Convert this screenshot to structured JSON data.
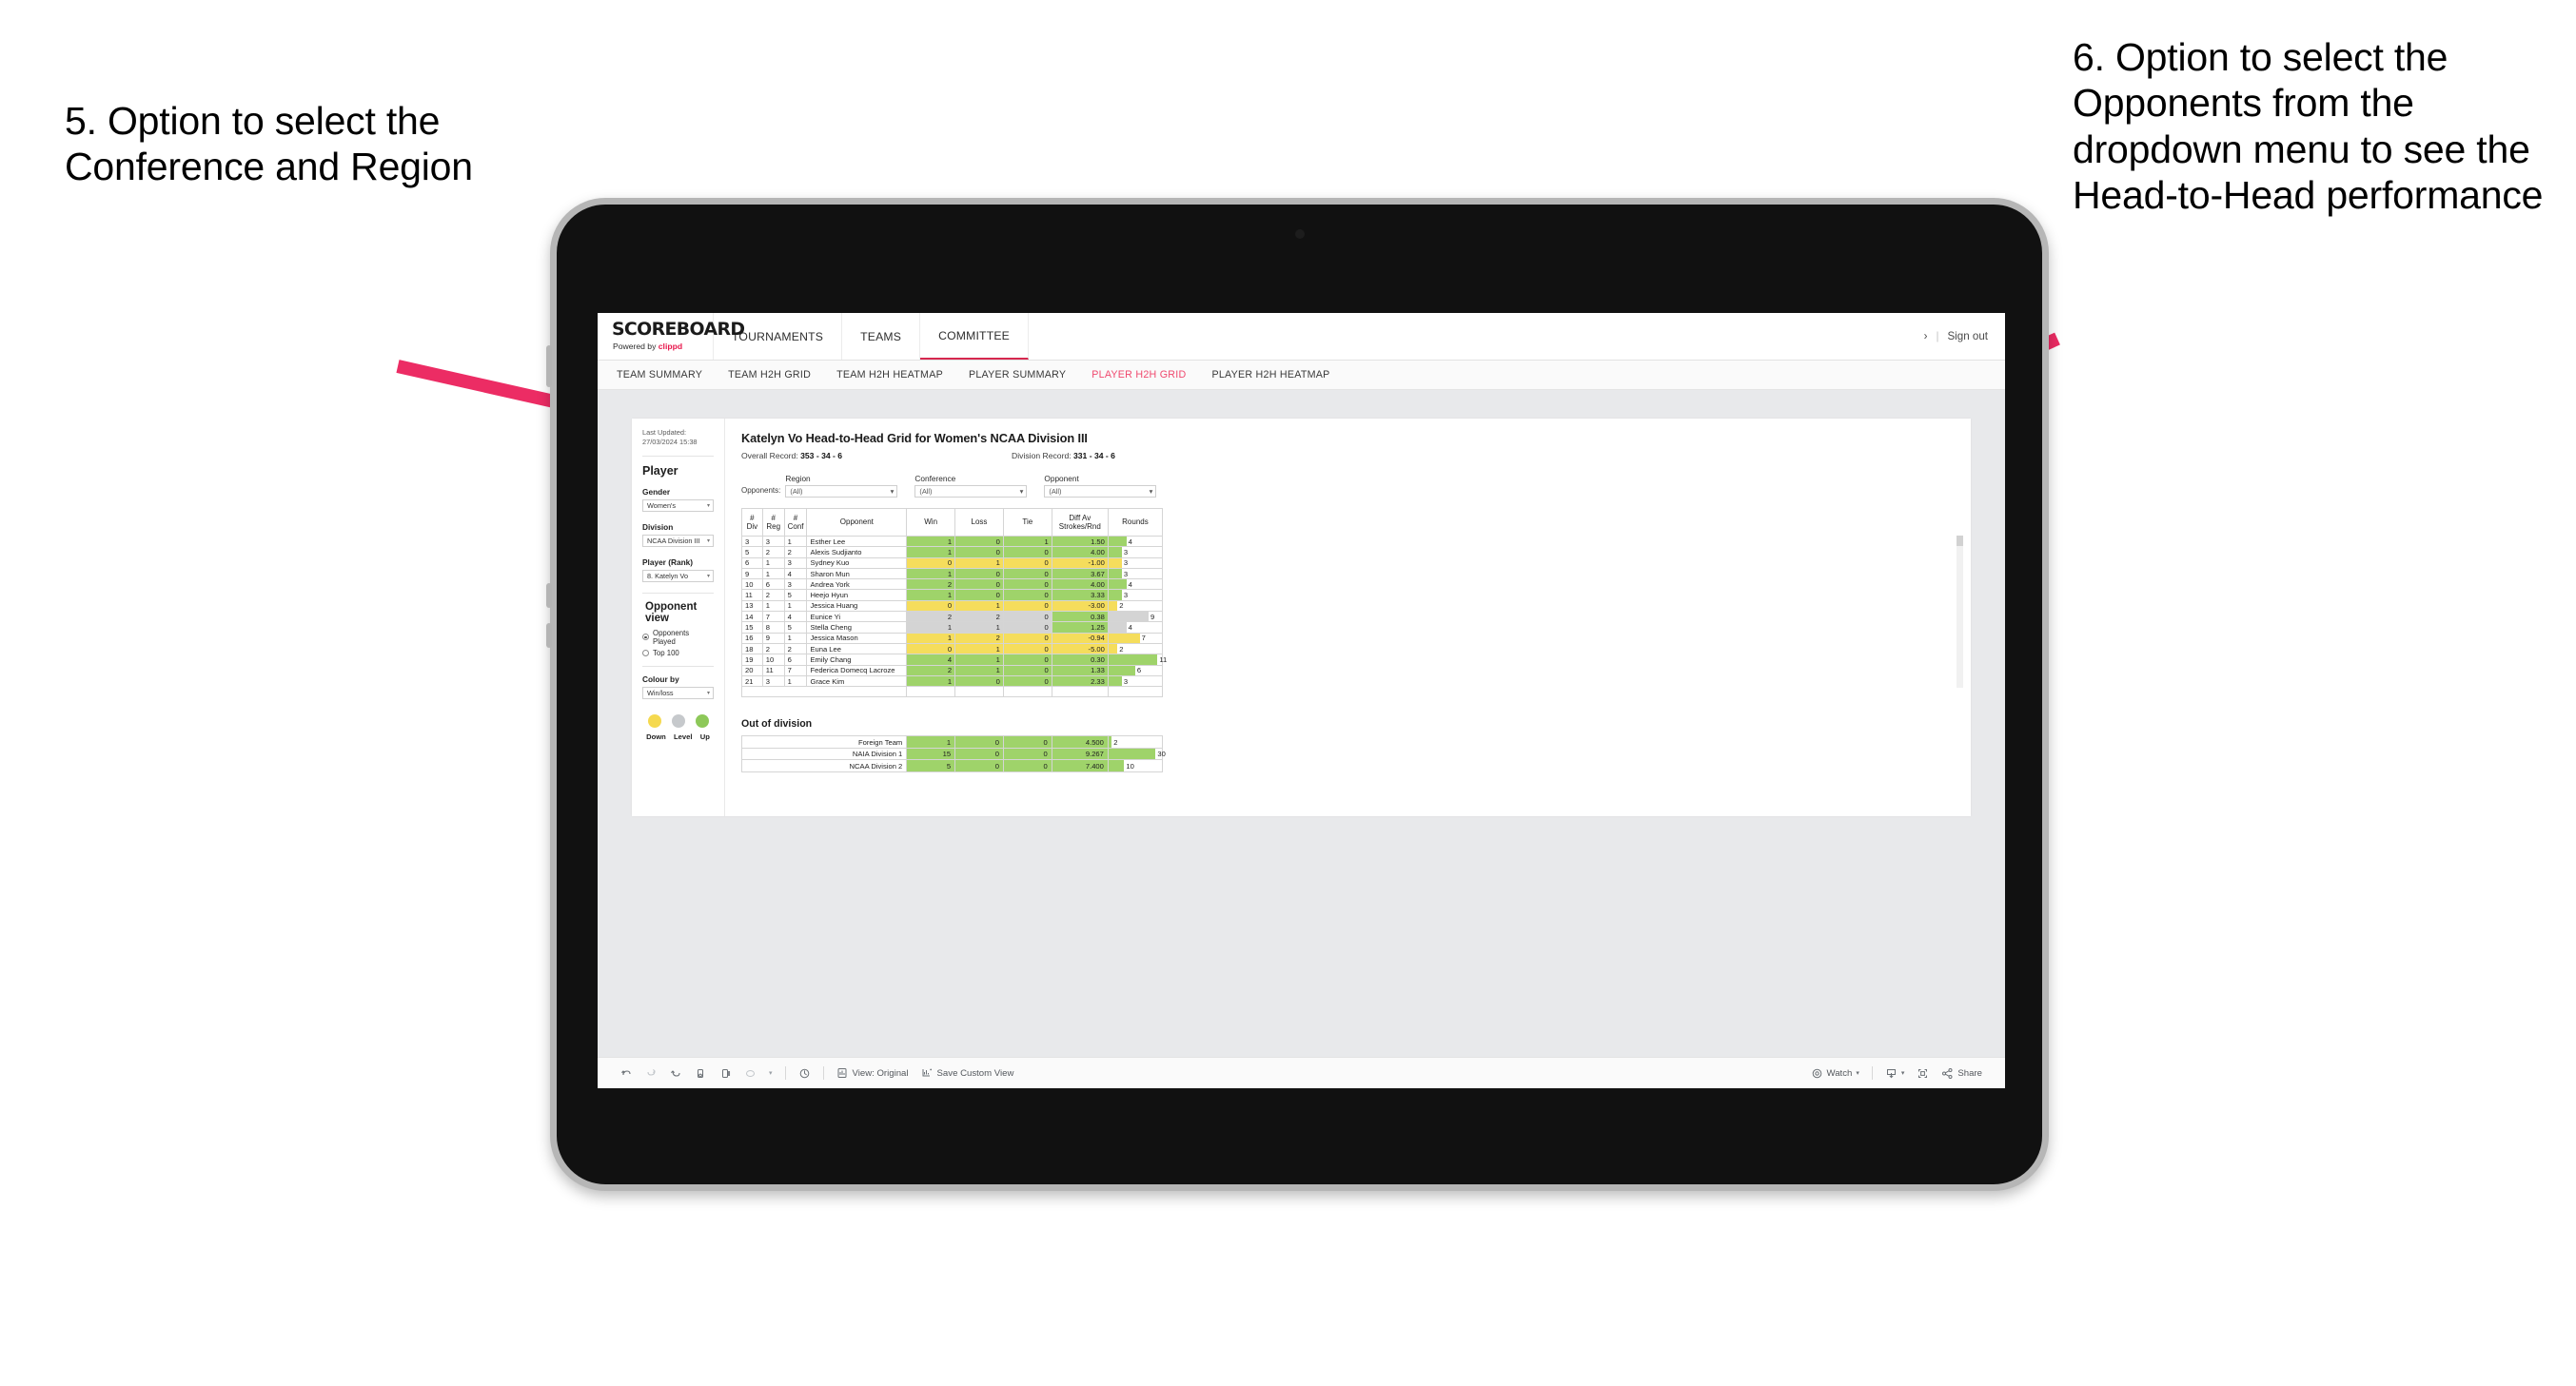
{
  "annotations": {
    "left": "5. Option to select the Conference and Region",
    "right": "6. Option to select the Opponents from the dropdown menu to see the Head-to-Head performance",
    "arrow_color": "#ec2c64"
  },
  "app": {
    "logo_main": "SCOREBOARD",
    "logo_sub_prefix": "Powered by ",
    "logo_sub_brand": "clippd",
    "top_nav": [
      {
        "label": "TOURNAMENTS",
        "active": false
      },
      {
        "label": "TEAMS",
        "active": false
      },
      {
        "label": "COMMITTEE",
        "active": true
      }
    ],
    "sign_out": "Sign out",
    "chevron": "›",
    "sub_nav": [
      {
        "label": "TEAM SUMMARY",
        "active": false
      },
      {
        "label": "TEAM H2H GRID",
        "active": false
      },
      {
        "label": "TEAM H2H HEATMAP",
        "active": false
      },
      {
        "label": "PLAYER SUMMARY",
        "active": false
      },
      {
        "label": "PLAYER H2H GRID",
        "active": true
      },
      {
        "label": "PLAYER H2H HEATMAP",
        "active": false
      }
    ]
  },
  "sidebar": {
    "last_updated": "Last Updated: 27/03/2024 15:38",
    "player_heading": "Player",
    "gender_label": "Gender",
    "gender_value": "Women's",
    "division_label": "Division",
    "division_value": "NCAA Division III",
    "player_rank_label": "Player (Rank)",
    "player_rank_value": "8. Katelyn Vo",
    "opponent_view_heading": "Opponent view",
    "radio_opponents_played": "Opponents Played",
    "radio_top100": "Top 100",
    "colour_by_label": "Colour by",
    "colour_by_value": "Win/loss",
    "legend": [
      {
        "label": "Down",
        "color": "#f5d94f"
      },
      {
        "label": "Level",
        "color": "#c6c9cc"
      },
      {
        "label": "Up",
        "color": "#8dc859"
      }
    ]
  },
  "main": {
    "title": "Katelyn Vo Head-to-Head Grid for Women's NCAA Division III",
    "overall_record_label": "Overall Record: ",
    "overall_record_value": "353 -  34 - 6",
    "division_record_label": "Division Record: ",
    "division_record_value": "331 -  34 - 6",
    "filters_label": "Opponents:",
    "filters": [
      {
        "title": "Region",
        "value": "(All)"
      },
      {
        "title": "Conference",
        "value": "(All)"
      },
      {
        "title": "Opponent",
        "value": "(All)"
      }
    ]
  },
  "chart_data": {
    "type": "table",
    "title": "Katelyn Vo Head-to-Head Grid for Women's NCAA Division III",
    "columns": [
      "# Div",
      "# Reg",
      "# Conf",
      "Opponent",
      "Win",
      "Loss",
      "Tie",
      "Diff Av Strokes/Rnd",
      "Rounds"
    ],
    "column_header_lines": [
      [
        "#",
        "Div"
      ],
      [
        "#",
        "Reg"
      ],
      [
        "#",
        "Conf"
      ],
      [
        "Opponent"
      ],
      [
        "Win"
      ],
      [
        "Loss"
      ],
      [
        "Tie"
      ],
      [
        "Diff Av",
        "Strokes/Rnd"
      ],
      [
        "Rounds"
      ]
    ],
    "rounds_max": 12,
    "rows": [
      {
        "div": "3",
        "reg": "3",
        "conf": "1",
        "opponent": "Esther Lee",
        "win": "1",
        "loss": "0",
        "tie": "1",
        "diff": "1.50",
        "rounds": 4,
        "color": "green"
      },
      {
        "div": "5",
        "reg": "2",
        "conf": "2",
        "opponent": "Alexis Sudjianto",
        "win": "1",
        "loss": "0",
        "tie": "0",
        "diff": "4.00",
        "rounds": 3,
        "color": "green"
      },
      {
        "div": "6",
        "reg": "1",
        "conf": "3",
        "opponent": "Sydney Kuo",
        "win": "0",
        "loss": "1",
        "tie": "0",
        "diff": "-1.00",
        "rounds": 3,
        "color": "yellow"
      },
      {
        "div": "9",
        "reg": "1",
        "conf": "4",
        "opponent": "Sharon Mun",
        "win": "1",
        "loss": "0",
        "tie": "0",
        "diff": "3.67",
        "rounds": 3,
        "color": "green"
      },
      {
        "div": "10",
        "reg": "6",
        "conf": "3",
        "opponent": "Andrea York",
        "win": "2",
        "loss": "0",
        "tie": "0",
        "diff": "4.00",
        "rounds": 4,
        "color": "green"
      },
      {
        "div": "11",
        "reg": "2",
        "conf": "5",
        "opponent": "Heejo Hyun",
        "win": "1",
        "loss": "0",
        "tie": "0",
        "diff": "3.33",
        "rounds": 3,
        "color": "green"
      },
      {
        "div": "13",
        "reg": "1",
        "conf": "1",
        "opponent": "Jessica Huang",
        "win": "0",
        "loss": "1",
        "tie": "0",
        "diff": "-3.00",
        "rounds": 2,
        "color": "yellow"
      },
      {
        "div": "14",
        "reg": "7",
        "conf": "4",
        "opponent": "Eunice Yi",
        "win": "2",
        "loss": "2",
        "tie": "0",
        "diff": "0.38",
        "rounds": 9,
        "color": "grey",
        "diff_color": "green"
      },
      {
        "div": "15",
        "reg": "8",
        "conf": "5",
        "opponent": "Stella Cheng",
        "win": "1",
        "loss": "1",
        "tie": "0",
        "diff": "1.25",
        "rounds": 4,
        "color": "grey",
        "diff_color": "green"
      },
      {
        "div": "16",
        "reg": "9",
        "conf": "1",
        "opponent": "Jessica Mason",
        "win": "1",
        "loss": "2",
        "tie": "0",
        "diff": "-0.94",
        "rounds": 7,
        "color": "yellow"
      },
      {
        "div": "18",
        "reg": "2",
        "conf": "2",
        "opponent": "Euna Lee",
        "win": "0",
        "loss": "1",
        "tie": "0",
        "diff": "-5.00",
        "rounds": 2,
        "color": "yellow"
      },
      {
        "div": "19",
        "reg": "10",
        "conf": "6",
        "opponent": "Emily Chang",
        "win": "4",
        "loss": "1",
        "tie": "0",
        "diff": "0.30",
        "rounds": 11,
        "color": "green"
      },
      {
        "div": "20",
        "reg": "11",
        "conf": "7",
        "opponent": "Federica Domecq Lacroze",
        "win": "2",
        "loss": "1",
        "tie": "0",
        "diff": "1.33",
        "rounds": 6,
        "color": "green"
      }
    ],
    "out_of_division_title": "Out of division",
    "out_of_division_rounds_max": 34,
    "out_of_division": [
      {
        "label": "Foreign Team",
        "win": "1",
        "loss": "0",
        "tie": "0",
        "diff": "4.500",
        "rounds": 2,
        "color": "green"
      },
      {
        "label": "NAIA Division 1",
        "win": "15",
        "loss": "0",
        "tie": "0",
        "diff": "9.267",
        "rounds": 30,
        "color": "green"
      },
      {
        "label": "NCAA Division 2",
        "win": "5",
        "loss": "0",
        "tie": "0",
        "diff": "7.400",
        "rounds": 10,
        "color": "green"
      }
    ]
  },
  "toolbar": {
    "view_label": "View: Original",
    "save_label": "Save Custom View",
    "watch_label": "Watch",
    "share_label": "Share",
    "caret": "▾"
  }
}
